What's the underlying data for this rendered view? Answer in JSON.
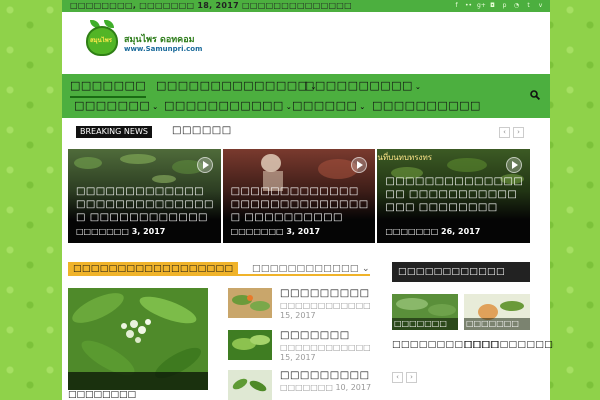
{
  "topbar": {
    "date": "□□□□□□□□, □□□□□□□ 18, 2017",
    "link": "□□□□□□□□□□□□□□",
    "social_icons": [
      "facebook-icon",
      "flickr-icon",
      "google-plus-icon",
      "instagram-icon",
      "pinterest-icon",
      "rss-icon",
      "twitter-icon",
      "vimeo-icon"
    ]
  },
  "logo": {
    "badge": "สมุนไพร",
    "line1": "สมุนไพร ดอทคอม",
    "line2": "www.Samunpri.com"
  },
  "nav": {
    "row1": [
      {
        "label": "□□□□□□□",
        "caret": false,
        "active": true
      },
      {
        "label": "□□□□□□□□□□□□□□",
        "caret": true,
        "active": false
      },
      {
        "label": "□□□□□□□□□□",
        "caret": true,
        "active": false
      }
    ],
    "row2": [
      {
        "label": "□□□□□□□",
        "caret": true,
        "active": false
      },
      {
        "label": "□□□□□□□□□□□",
        "caret": true,
        "active": false
      },
      {
        "label": "□□□□□□",
        "caret": true,
        "active": false
      },
      {
        "label": "□□□□□□□□□□",
        "caret": false,
        "active": false
      }
    ],
    "caret_glyph": "⌄"
  },
  "breaking": {
    "label": "BREAKING NEWS",
    "text": "□□□□□□",
    "prev": "‹",
    "next": "›"
  },
  "featured": [
    {
      "title": "□□□□□□□□□□□□□ □□□□□□□□□□□□□□□ □□□□□□□□□□□□",
      "date": "□□□□□□□ 3, 2017",
      "tag": ""
    },
    {
      "title": "□□□□□□□□□□□□□ □□□□□□□□□□□□□□□ □□□□□□□□□□",
      "date": "□□□□□□□ 3, 2017",
      "tag": ""
    },
    {
      "title": "□□□□□□□□□□□□□□□□ □□□□□□□□□□□□□□ □□□□□□□□",
      "date": "□□□□□□□ 26, 2017",
      "tag": "นที่บนทบทรงทร"
    }
  ],
  "block": {
    "label": "□□□□□□□□□□□□□□□□□□",
    "more": "□□□□□□□□□□□□ ⌄",
    "big_title": "□□□□□□□□",
    "items": [
      {
        "title": "□□□□□□□□□",
        "date": "□□□□□□□□□□□□ 15, 2017"
      },
      {
        "title": "□□□□□□□",
        "date": "□□□□□□□□□□□□ 15, 2017"
      },
      {
        "title": "□□□□□□□□□",
        "date": "□□□□□□□ 10, 2017"
      }
    ]
  },
  "side": {
    "head": "□□□□□□□□□□□□",
    "cards": [
      {
        "overlay": "□□□□□□□",
        "caption": "□□□□□□□□□□□□"
      },
      {
        "overlay": "□□□□□□□",
        "caption": "□□□□□□□□□□"
      }
    ],
    "prev": "‹",
    "next": "›"
  }
}
